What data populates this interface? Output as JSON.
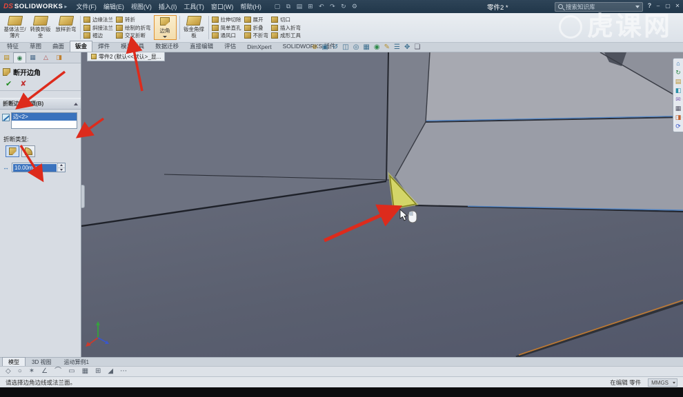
{
  "colors": {
    "selection_blue": "#3a72bd",
    "highlight_yellow": "#d8d967",
    "arrow_red": "#dd2b1c",
    "edge_orange": "#c07a30",
    "titlebar_navy": "#2a3f53"
  },
  "title_bar": {
    "logo_ds": "DS",
    "logo_text": "SOLIDWORKS",
    "logo_caret": "▸",
    "menus": [
      "文件(F)",
      "编辑(E)",
      "视图(V)",
      "插入(I)",
      "工具(T)",
      "窗口(W)",
      "帮助(H)"
    ],
    "document_title": "零件2 *",
    "search_placeholder": "搜索知识库",
    "help_glyph": "?"
  },
  "window_icons": [
    "–",
    "▢",
    "✕"
  ],
  "quick_icons": [
    "▢",
    "⧉",
    "▤",
    "⊞",
    "↶",
    "↷",
    "↻",
    "⚙"
  ],
  "ribbon": {
    "large": [
      "基体法兰/薄片",
      "转换到钣金",
      "放样折弯",
      "钣金角撑板"
    ],
    "stack1": [
      "边缘法兰",
      "斜接法兰",
      "褶边"
    ],
    "stack2": [
      "转折",
      "绘制的折弯",
      "交叉折断"
    ],
    "corner_label": "边角",
    "stack3": [
      "拉伸切除",
      "简单直孔",
      "通风口"
    ],
    "stack4": [
      "展开",
      "折叠",
      "不折弯"
    ],
    "stack5": [
      "切口",
      "插入折弯",
      "成形工具"
    ]
  },
  "command_tabs": [
    "特征",
    "草图",
    "曲面",
    "钣金",
    "焊件",
    "模具工具",
    "数据迁移",
    "直接编辑",
    "评估",
    "DimXpert",
    "SOLIDWORKS 插件"
  ],
  "panel_tab_icons": [
    "▤",
    "◉",
    "▦",
    "△",
    "◨"
  ],
  "property_manager": {
    "title": "断开边角",
    "ok_glyph": "✔",
    "cancel_glyph": "✘",
    "group_header": "折断边角选项(B)",
    "selected_edge": "边<2>",
    "break_type_label": "折断类型:",
    "distance_value": "10.00mm"
  },
  "panel_icons": {
    "distance": "↔"
  },
  "hud_icons": [
    "⊕",
    "▣",
    "↺",
    "◫",
    "◎",
    "▦",
    "◉",
    "✎",
    "☰",
    "✥",
    "❏"
  ],
  "right_toolbar_icons": [
    "⌂",
    "↻",
    "▤",
    "◧",
    "✉",
    "▦",
    "◨",
    "⟳"
  ],
  "bottom_toolbar_icons": [
    "◇",
    "○",
    "✶",
    "∠",
    "⌒",
    "▭",
    "▦",
    "⊞",
    "◢",
    "⋯"
  ],
  "viewport": {
    "doc_tab": "零件2 (默认<<默认>_显...",
    "watermark": "虎课网"
  },
  "bottom": {
    "tabs": [
      "模型",
      "3D 视图",
      "运动算例1"
    ],
    "status_message": "请选择边角边线或法兰面。",
    "editing_status": "在编辑 零件",
    "units": "MMGS"
  }
}
